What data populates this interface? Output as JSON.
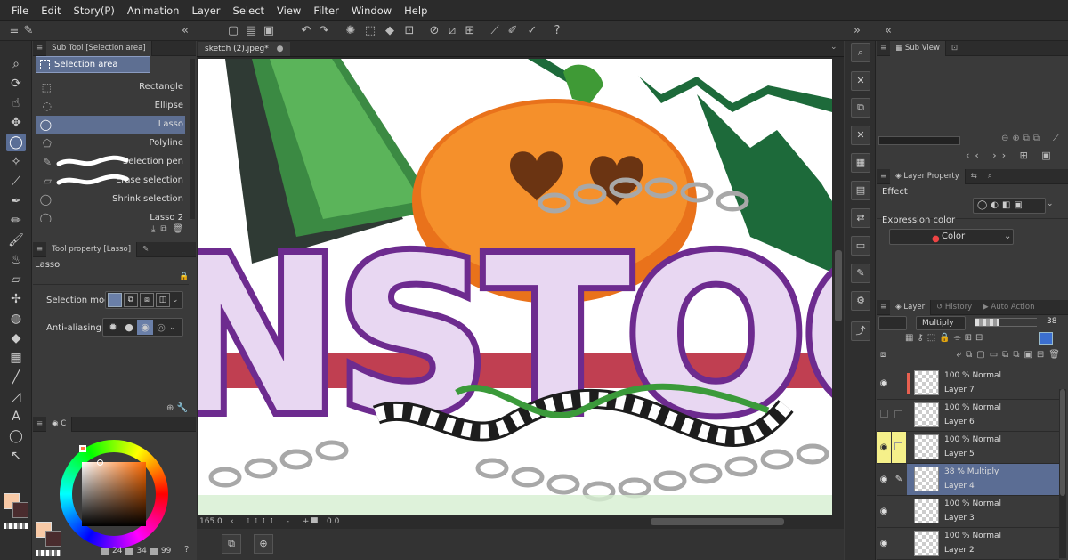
{
  "menu": [
    "File",
    "Edit",
    "Story(P)",
    "Animation",
    "Layer",
    "Select",
    "View",
    "Filter",
    "Window",
    "Help"
  ],
  "subtool": {
    "tab_label": "Sub Tool [Selection area]",
    "group_label": "Selection area",
    "items": [
      "Rectangle",
      "Ellipse",
      "Lasso",
      "Polyline",
      "Selection pen",
      "Erase selection",
      "Shrink selection",
      "Lasso 2"
    ],
    "selected": "Lasso"
  },
  "toolprop": {
    "tab_label": "Tool property [Lasso]",
    "tool_name": "Lasso",
    "selection_mode_label": "Selection mode",
    "anti_aliasing_label": "Anti-aliasing"
  },
  "color": {
    "tab_label": "C",
    "main_color": "#f7c9a6",
    "sub_color": "#4a2c2e",
    "values": [
      "24",
      "34",
      "99"
    ]
  },
  "document": {
    "tab_label": "sketch (2).jpeg*",
    "zoom": "165.0",
    "rotation": "0.0"
  },
  "artwork": {
    "title_text": "NSTOC"
  },
  "subview": {
    "tab_label": "Sub View"
  },
  "layerprop": {
    "tab_label": "Layer Property",
    "effect_label": "Effect",
    "expression_label": "Expression color",
    "expression_value": "Color"
  },
  "layers": {
    "tab_label": "Layer",
    "history_label": "History",
    "auto_action_label": "Auto Action",
    "blend_mode": "Multiply",
    "opacity": "38",
    "items": [
      {
        "mode": "100 % Normal",
        "name": "Layer 7"
      },
      {
        "mode": "100 % Normal",
        "name": "Layer 6"
      },
      {
        "mode": "100 % Normal",
        "name": "Layer 5"
      },
      {
        "mode": "38 % Multiply",
        "name": "Layer 4"
      },
      {
        "mode": "100 % Normal",
        "name": "Layer 3"
      },
      {
        "mode": "100 % Normal",
        "name": "Layer 2"
      }
    ]
  },
  "colors": {
    "accent": "#5e6f92",
    "panel": "#3a3a3a",
    "highlight_yellow": "#f5f08a"
  }
}
